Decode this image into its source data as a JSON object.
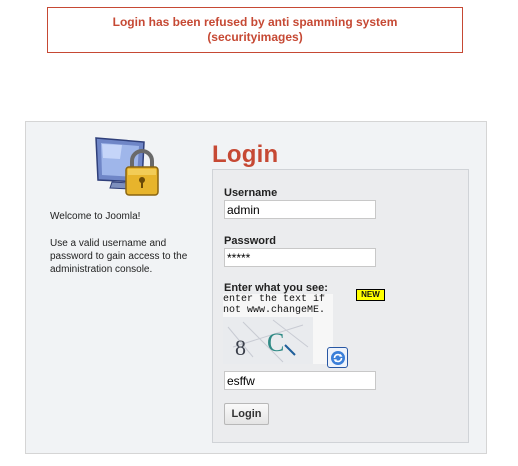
{
  "error": {
    "message": "Login has been refused by anti spamming system\n(securityimages)",
    "color": "#c64934"
  },
  "sidebar": {
    "icon": "monitor-lock-icon",
    "welcome_title": "Welcome to Joomla!",
    "welcome_desc": "Use a valid username and password to gain access to the administration console."
  },
  "login": {
    "heading": "Login",
    "username_label": "Username",
    "username_value": "admin",
    "password_label": "Password",
    "password_value": "*****",
    "captcha_label": "Enter what you see:",
    "captcha_badge": "NEW",
    "captcha_hint_line1": "enter the text if",
    "captcha_hint_line2": "not www.changeME.",
    "captcha_chars": "8C",
    "refresh_icon": "refresh-icon",
    "captcha_value": "esffw",
    "button_label": "Login"
  }
}
